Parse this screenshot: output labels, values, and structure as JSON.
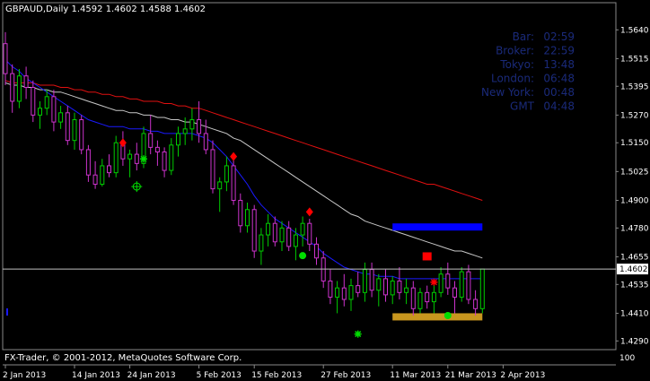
{
  "header": {
    "title": "GBPAUD,Daily  1.4592 1.4602 1.4588 1.4602"
  },
  "footer": {
    "copyright": "FX-Trader, © 2001-2012, MetaQuotes Software Corp.",
    "subwindow_value": "100"
  },
  "clock_panel": {
    "rows": [
      {
        "label": "Bar:",
        "value": "02:59"
      },
      {
        "label": "Broker:",
        "value": "22:59"
      },
      {
        "label": "Tokyo:",
        "value": "13:48"
      },
      {
        "label": "London:",
        "value": "06:48"
      },
      {
        "label": "New York:",
        "value": "00:48"
      },
      {
        "label": "GMT",
        "value": "04:48"
      }
    ],
    "label_color": "#1a2a7a",
    "value_color": "#1a2a7a"
  },
  "colors": {
    "background": "#000000",
    "bull_candle": "#00cc00",
    "bear_candle": "#cc33cc",
    "ma_fast": "#1a1aff",
    "ma_mid": "#c8c8c8",
    "ma_slow": "#e01010",
    "resistance_zone": "#0000ff",
    "support_zone": "#c8961e",
    "price_line": "#c0c0c0"
  },
  "chart_data": {
    "type": "candlestick",
    "symbol": "GBPAUD",
    "timeframe": "Daily",
    "current_price": "1.4602",
    "ylim": [
      1.426,
      1.575
    ],
    "yticks": [
      "1.5640",
      "1.5515",
      "1.5395",
      "1.5270",
      "1.5150",
      "1.5025",
      "1.4900",
      "1.4780",
      "1.4655",
      "1.4535",
      "1.4410",
      "1.4290"
    ],
    "xticks": [
      "2 Jan 2013",
      "14 Jan 2013",
      "24 Jan 2013",
      "5 Feb 2013",
      "15 Feb 2013",
      "27 Feb 2013",
      "11 Mar 2013",
      "21 Mar 2013",
      "2 Apr 2013"
    ],
    "xtick_index": [
      0,
      10,
      18,
      28,
      36,
      46,
      56,
      64,
      72
    ],
    "ohlc": [
      [
        1.558,
        1.563,
        1.54,
        1.545
      ],
      [
        1.545,
        1.549,
        1.528,
        1.533
      ],
      [
        1.533,
        1.547,
        1.53,
        1.544
      ],
      [
        1.544,
        1.548,
        1.534,
        1.539
      ],
      [
        1.539,
        1.542,
        1.524,
        1.527
      ],
      [
        1.527,
        1.533,
        1.521,
        1.53
      ],
      [
        1.53,
        1.538,
        1.527,
        1.535
      ],
      [
        1.535,
        1.538,
        1.52,
        1.524
      ],
      [
        1.524,
        1.531,
        1.521,
        1.528
      ],
      [
        1.528,
        1.531,
        1.514,
        1.516
      ],
      [
        1.516,
        1.528,
        1.512,
        1.525
      ],
      [
        1.525,
        1.527,
        1.51,
        1.512
      ],
      [
        1.512,
        1.514,
        1.498,
        1.501
      ],
      [
        1.501,
        1.507,
        1.495,
        1.497
      ],
      [
        1.497,
        1.508,
        1.496,
        1.505
      ],
      [
        1.505,
        1.51,
        1.5,
        1.502
      ],
      [
        1.502,
        1.518,
        1.5,
        1.515
      ],
      [
        1.515,
        1.52,
        1.505,
        1.508
      ],
      [
        1.508,
        1.512,
        1.5,
        1.51
      ],
      [
        1.51,
        1.515,
        1.503,
        1.506
      ],
      [
        1.506,
        1.522,
        1.504,
        1.519
      ],
      [
        1.519,
        1.527,
        1.51,
        1.513
      ],
      [
        1.513,
        1.516,
        1.505,
        1.511
      ],
      [
        1.511,
        1.513,
        1.5,
        1.503
      ],
      [
        1.503,
        1.517,
        1.501,
        1.514
      ],
      [
        1.514,
        1.522,
        1.509,
        1.519
      ],
      [
        1.519,
        1.526,
        1.514,
        1.521
      ],
      [
        1.521,
        1.53,
        1.516,
        1.525
      ],
      [
        1.525,
        1.533,
        1.515,
        1.519
      ],
      [
        1.519,
        1.525,
        1.51,
        1.512
      ],
      [
        1.512,
        1.516,
        1.493,
        1.495
      ],
      [
        1.495,
        1.5,
        1.485,
        1.498
      ],
      [
        1.498,
        1.509,
        1.494,
        1.505
      ],
      [
        1.505,
        1.508,
        1.488,
        1.49
      ],
      [
        1.49,
        1.493,
        1.476,
        1.479
      ],
      [
        1.479,
        1.489,
        1.476,
        1.486
      ],
      [
        1.486,
        1.488,
        1.465,
        1.468
      ],
      [
        1.468,
        1.478,
        1.462,
        1.475
      ],
      [
        1.475,
        1.484,
        1.47,
        1.48
      ],
      [
        1.48,
        1.483,
        1.47,
        1.472
      ],
      [
        1.472,
        1.481,
        1.468,
        1.478
      ],
      [
        1.478,
        1.481,
        1.468,
        1.47
      ],
      [
        1.47,
        1.478,
        1.464,
        1.475
      ],
      [
        1.475,
        1.483,
        1.47,
        1.48
      ],
      [
        1.48,
        1.482,
        1.468,
        1.471
      ],
      [
        1.471,
        1.474,
        1.462,
        1.465
      ],
      [
        1.465,
        1.468,
        1.452,
        1.455
      ],
      [
        1.455,
        1.46,
        1.445,
        1.448
      ],
      [
        1.448,
        1.455,
        1.441,
        1.452
      ],
      [
        1.452,
        1.458,
        1.444,
        1.447
      ],
      [
        1.447,
        1.456,
        1.442,
        1.453
      ],
      [
        1.453,
        1.459,
        1.448,
        1.45
      ],
      [
        1.45,
        1.463,
        1.446,
        1.46
      ],
      [
        1.46,
        1.463,
        1.448,
        1.451
      ],
      [
        1.451,
        1.458,
        1.444,
        1.456
      ],
      [
        1.456,
        1.46,
        1.446,
        1.449
      ],
      [
        1.449,
        1.457,
        1.445,
        1.455
      ],
      [
        1.455,
        1.461,
        1.447,
        1.45
      ],
      [
        1.45,
        1.456,
        1.445,
        1.452
      ],
      [
        1.452,
        1.455,
        1.44,
        1.443
      ],
      [
        1.443,
        1.452,
        1.441,
        1.45
      ],
      [
        1.45,
        1.453,
        1.443,
        1.446
      ],
      [
        1.446,
        1.453,
        1.441,
        1.45
      ],
      [
        1.45,
        1.461,
        1.448,
        1.458
      ],
      [
        1.458,
        1.463,
        1.449,
        1.452
      ],
      [
        1.452,
        1.455,
        1.441,
        1.448
      ],
      [
        1.448,
        1.461,
        1.446,
        1.459
      ],
      [
        1.459,
        1.462,
        1.445,
        1.447
      ],
      [
        1.447,
        1.451,
        1.44,
        1.443
      ],
      [
        1.443,
        1.46,
        1.441,
        1.4602
      ]
    ],
    "ma_fast": [
      1.551,
      1.548,
      1.546,
      1.543,
      1.541,
      1.539,
      1.537,
      1.535,
      1.533,
      1.531,
      1.529,
      1.527,
      1.525,
      1.524,
      1.523,
      1.522,
      1.522,
      1.522,
      1.521,
      1.521,
      1.521,
      1.52,
      1.52,
      1.519,
      1.519,
      1.519,
      1.519,
      1.519,
      1.518,
      1.517,
      1.515,
      1.512,
      1.509,
      1.505,
      1.501,
      1.497,
      1.492,
      1.488,
      1.485,
      1.482,
      1.48,
      1.478,
      1.476,
      1.474,
      1.472,
      1.47,
      1.467,
      1.465,
      1.463,
      1.461,
      1.46,
      1.459,
      1.458,
      1.458,
      1.457,
      1.457,
      1.457,
      1.456,
      1.456,
      1.456,
      1.456,
      1.456,
      1.456,
      1.456,
      1.456,
      1.456,
      1.456,
      1.456,
      1.456,
      1.456
    ],
    "ma_mid": [
      1.541,
      1.54,
      1.54,
      1.539,
      1.539,
      1.538,
      1.538,
      1.537,
      1.537,
      1.536,
      1.535,
      1.534,
      1.533,
      1.532,
      1.531,
      1.53,
      1.529,
      1.529,
      1.528,
      1.528,
      1.527,
      1.527,
      1.526,
      1.526,
      1.525,
      1.525,
      1.524,
      1.524,
      1.523,
      1.522,
      1.521,
      1.52,
      1.519,
      1.517,
      1.516,
      1.514,
      1.512,
      1.51,
      1.508,
      1.506,
      1.504,
      1.502,
      1.5,
      1.498,
      1.496,
      1.494,
      1.492,
      1.49,
      1.488,
      1.486,
      1.484,
      1.483,
      1.481,
      1.48,
      1.479,
      1.478,
      1.477,
      1.476,
      1.475,
      1.474,
      1.473,
      1.472,
      1.471,
      1.47,
      1.469,
      1.468,
      1.468,
      1.467,
      1.466,
      1.465
    ],
    "ma_slow": [
      1.542,
      1.541,
      1.541,
      1.541,
      1.541,
      1.54,
      1.54,
      1.54,
      1.539,
      1.539,
      1.538,
      1.538,
      1.537,
      1.537,
      1.536,
      1.536,
      1.535,
      1.535,
      1.534,
      1.534,
      1.533,
      1.533,
      1.533,
      1.532,
      1.532,
      1.531,
      1.531,
      1.53,
      1.53,
      1.529,
      1.528,
      1.527,
      1.526,
      1.525,
      1.524,
      1.523,
      1.522,
      1.521,
      1.52,
      1.519,
      1.518,
      1.517,
      1.516,
      1.515,
      1.514,
      1.513,
      1.512,
      1.511,
      1.51,
      1.509,
      1.508,
      1.507,
      1.506,
      1.505,
      1.504,
      1.503,
      1.502,
      1.501,
      1.5,
      1.499,
      1.498,
      1.497,
      1.497,
      1.496,
      1.495,
      1.494,
      1.493,
      1.492,
      1.491,
      1.49
    ],
    "zones": [
      {
        "name": "resistance",
        "y1": 1.477,
        "y2": 1.48,
        "from": 56,
        "to": 69
      },
      {
        "name": "support",
        "y1": 1.439,
        "y2": 1.441,
        "from": 56,
        "to": 69
      }
    ],
    "signals": [
      {
        "kind": "red-diamond",
        "i": 17,
        "y": 1.515
      },
      {
        "kind": "red-diamond",
        "i": 33,
        "y": 1.509
      },
      {
        "kind": "red-diamond",
        "i": 44,
        "y": 1.485
      },
      {
        "kind": "red-square",
        "i": 61,
        "y": 1.4655
      },
      {
        "kind": "red-star",
        "i": 62,
        "y": 1.4545
      },
      {
        "kind": "green-star",
        "i": 20,
        "y": 1.508
      },
      {
        "kind": "green-circle-cross",
        "i": 19,
        "y": 1.496
      },
      {
        "kind": "green-dot",
        "i": 43,
        "y": 1.466
      },
      {
        "kind": "green-star",
        "i": 51,
        "y": 1.432
      },
      {
        "kind": "green-dot",
        "i": 64,
        "y": 1.44
      }
    ]
  }
}
